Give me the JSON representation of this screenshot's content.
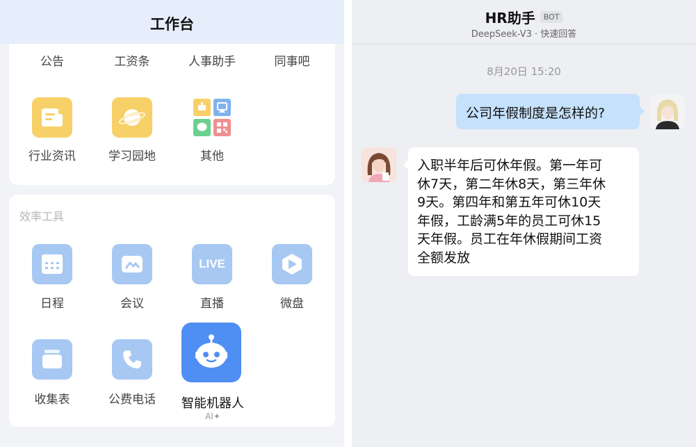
{
  "workbench": {
    "title": "工作台",
    "top_row": [
      "公告",
      "工资条",
      "人事助手",
      "同事吧"
    ],
    "apps": [
      {
        "label": "行业资讯",
        "icon": "document-icon"
      },
      {
        "label": "学习园地",
        "icon": "planet-icon"
      },
      {
        "label": "其他",
        "icon": "apps-grid-icon"
      }
    ],
    "tools_title": "效率工具",
    "tools": [
      {
        "label": "日程",
        "icon": "calendar-icon"
      },
      {
        "label": "会议",
        "icon": "meeting-icon"
      },
      {
        "label": "直播",
        "icon": "live-icon",
        "icon_text": "LIVE"
      },
      {
        "label": "微盘",
        "icon": "cloud-drive-icon"
      },
      {
        "label": "收集表",
        "icon": "form-icon"
      },
      {
        "label": "公费电话",
        "icon": "phone-icon"
      }
    ],
    "robot": {
      "label": "智能机器人",
      "sublabel": "AI✦",
      "icon": "robot-icon"
    }
  },
  "chat": {
    "title": "HR助手",
    "badge": "BOT",
    "subtitle": "DeepSeek-V3 · 快速回答",
    "timestamp": "8月20日 15:20",
    "messages": [
      {
        "from": "user",
        "text": "公司年假制度是怎样的?"
      },
      {
        "from": "bot",
        "lines": [
          "入职半年后可休年假。第一年可",
          "休7天，第二年休8天，第三年休",
          "9天。第四年和第五年可休10天",
          "年假，工龄满5年的员工可休15",
          "天年假。员工在年休假期间工资",
          "全额发放"
        ]
      }
    ]
  },
  "colors": {
    "accent": "#4f8ef3",
    "yellow_icon": "#f7d067",
    "blue_icon": "#a7c8f3",
    "user_bubble": "#c6e1fb"
  }
}
